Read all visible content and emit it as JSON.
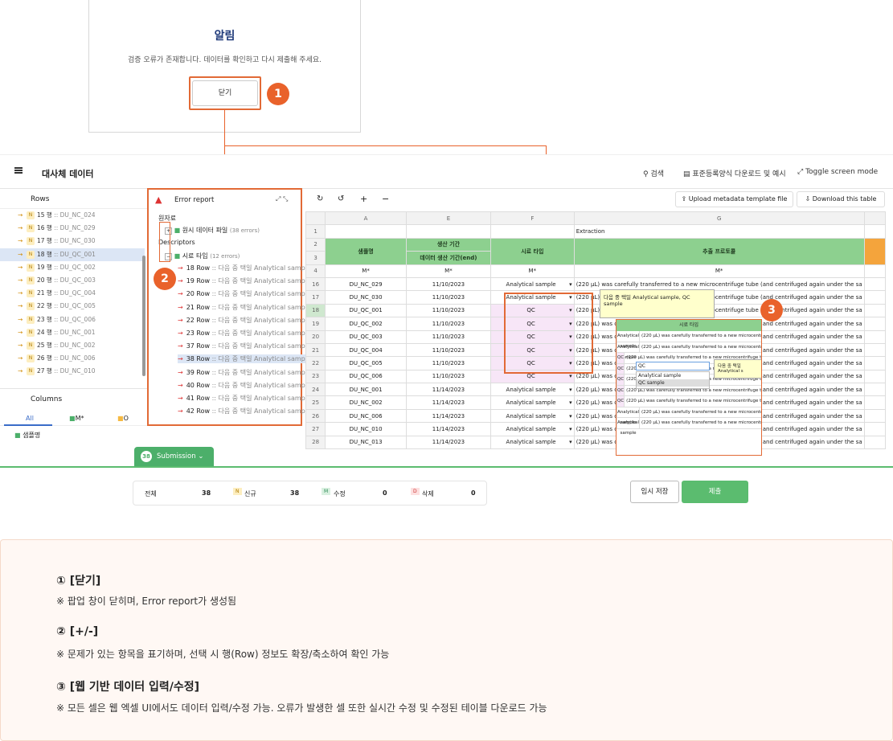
{
  "modal": {
    "title": "알림",
    "message": "검증 오류가 존재합니다. 데이터를 확인하고 다시 제출해 주세요.",
    "close_label": "닫기"
  },
  "badges": [
    "1",
    "2",
    "3"
  ],
  "topbar": {
    "title": "대사체 데이터",
    "search": "검색",
    "download_format": "표준등록양식 다운로드 및 예시",
    "toggle": "Toggle screen mode"
  },
  "rows_panel": {
    "title": "Rows",
    "items": [
      {
        "label": "15 행",
        "code": ":: DU_NC_024"
      },
      {
        "label": "16 행",
        "code": ":: DU_NC_029"
      },
      {
        "label": "17 행",
        "code": ":: DU_NC_030"
      },
      {
        "label": "18 행",
        "code": ":: DU_QC_001"
      },
      {
        "label": "19 행",
        "code": ":: DU_QC_002"
      },
      {
        "label": "20 행",
        "code": ":: DU_QC_003"
      },
      {
        "label": "21 행",
        "code": ":: DU_QC_004"
      },
      {
        "label": "22 행",
        "code": ":: DU_QC_005"
      },
      {
        "label": "23 행",
        "code": ":: DU_QC_006"
      },
      {
        "label": "24 행",
        "code": ":: DU_NC_001"
      },
      {
        "label": "25 행",
        "code": ":: DU_NC_002"
      },
      {
        "label": "26 행",
        "code": ":: DU_NC_006"
      },
      {
        "label": "27 행",
        "code": ":: DU_NC_010"
      }
    ],
    "badge": "N"
  },
  "columns_panel": {
    "title": "Columns",
    "tabs": [
      "All",
      "M*",
      "O"
    ],
    "first": "샘플명"
  },
  "error_report": {
    "title": "Error report",
    "group1": "원자료",
    "item1": "원시 데이터 파일",
    "item1_count": "(38 errors)",
    "group2": "Descriptors",
    "item2": "시료 타입",
    "item2_count": "(12 errors)",
    "rows": [
      "18 Row",
      "19 Row",
      "20 Row",
      "21 Row",
      "22 Row",
      "23 Row",
      "37 Row",
      "38 Row",
      "39 Row",
      "40 Row",
      "41 Row",
      "42 Row"
    ],
    "row_msg": ":: 다음 중 택일 Analytical sample"
  },
  "grid_toolbar": {
    "upload": "Upload metadata template file",
    "download": "Download this table"
  },
  "grid": {
    "cols": [
      "A",
      "E",
      "F",
      "G"
    ],
    "row1": "Extraction",
    "h_a": "샘플명",
    "h_e1": "생산 기간",
    "h_e2": "데이터 생산 기간(end)",
    "h_f": "시료 타입",
    "h_g": "추출 프로토콜",
    "mstar": "M*",
    "rows": [
      {
        "n": "16",
        "a": "DU_NC_029",
        "e": "11/10/2023",
        "f": "Analytical sample"
      },
      {
        "n": "17",
        "a": "DU_NC_030",
        "e": "11/10/2023",
        "f": "Analytical sample"
      },
      {
        "n": "18",
        "a": "DU_QC_001",
        "e": "11/10/2023",
        "f": "QC"
      },
      {
        "n": "19",
        "a": "DU_QC_002",
        "e": "11/10/2023",
        "f": "QC"
      },
      {
        "n": "20",
        "a": "DU_QC_003",
        "e": "11/10/2023",
        "f": "QC"
      },
      {
        "n": "21",
        "a": "DU_QC_004",
        "e": "11/10/2023",
        "f": "QC"
      },
      {
        "n": "22",
        "a": "DU_QC_005",
        "e": "11/10/2023",
        "f": "QC"
      },
      {
        "n": "23",
        "a": "DU_QC_006",
        "e": "11/10/2023",
        "f": "QC"
      },
      {
        "n": "24",
        "a": "DU_NC_001",
        "e": "11/14/2023",
        "f": "Analytical sample"
      },
      {
        "n": "25",
        "a": "DU_NC_002",
        "e": "11/14/2023",
        "f": "Analytical sample"
      },
      {
        "n": "26",
        "a": "DU_NC_006",
        "e": "11/14/2023",
        "f": "Analytical sample"
      },
      {
        "n": "27",
        "a": "DU_NC_010",
        "e": "11/14/2023",
        "f": "Analytical sample"
      },
      {
        "n": "28",
        "a": "DU_NC_013",
        "e": "11/14/2023",
        "f": "Analytical sample"
      }
    ],
    "protocol": "(220 μL) was carefully transferred to a new microcentrifuge tube (and centrifuged again under the sa",
    "tooltip": "다음 중 택일 Analytical sample, QC sample"
  },
  "mini": {
    "head": "시료 타입",
    "input": "QC",
    "opt1": "Analytical sample",
    "opt2": "QC sample",
    "tip": "다음 중 택일 Analytical s"
  },
  "submission": {
    "count": "38",
    "label": "Submission"
  },
  "stats": {
    "total_label": "전체",
    "total": "38",
    "new_label": "신규",
    "new": "38",
    "mod_label": "수정",
    "mod": "0",
    "del_label": "삭제",
    "del": "0"
  },
  "actions": {
    "save": "임시 저장",
    "submit": "제출"
  },
  "notes": [
    {
      "title": "① [닫기]",
      "desc": "※ 팝업 창이 닫히며, Error report가 생성됨"
    },
    {
      "title": "② [+/-]",
      "desc": "※ 문제가 있는 항목을 표기하며, 선택 시 행(Row) 정보도 확장/축소하여 확인 가능"
    },
    {
      "title": "③ [웹 기반 데이터 입력/수정]",
      "desc": "※ 모든 셀은 웹 엑셀 UI에서도 데이터 입력/수정 가능. 오류가 발생한 셀 또한 실시간 수정 및 수정된 테이블 다운로드 가능"
    }
  ]
}
